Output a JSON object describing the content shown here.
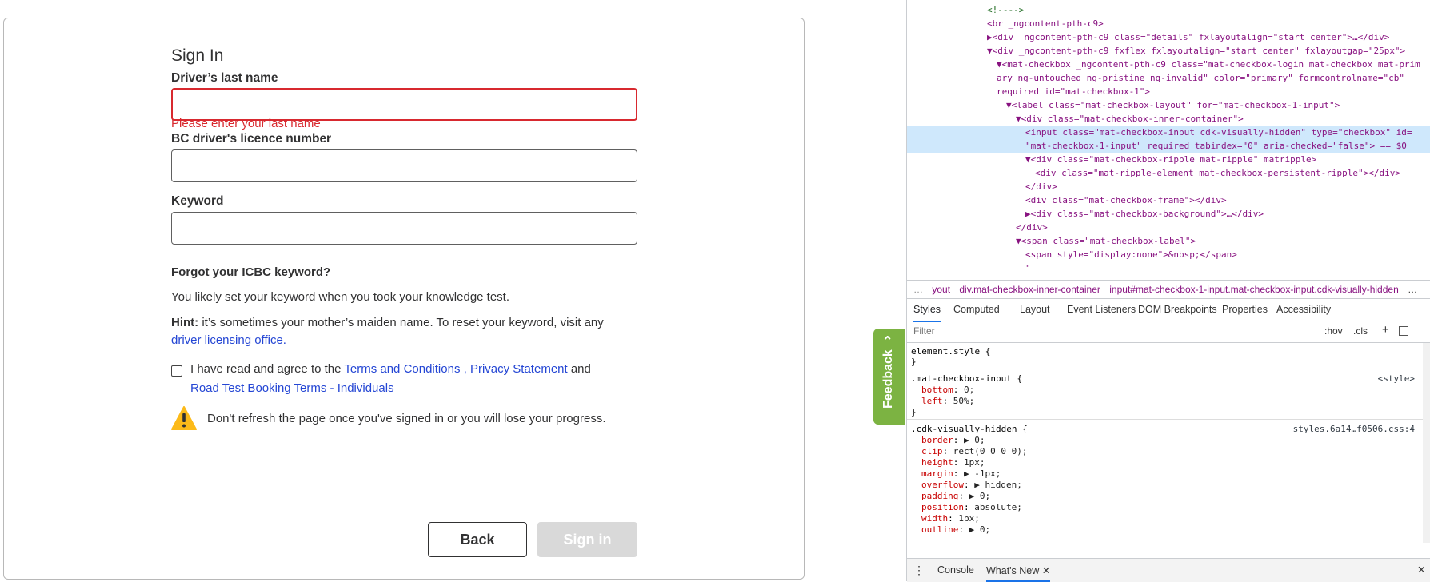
{
  "form": {
    "title": "Sign In",
    "last_name_label": "Driver’s last name",
    "last_name_value": "",
    "last_name_error": "Please enter your last name",
    "licence_label": "BC driver's licence number",
    "licence_value": "",
    "keyword_label": "Keyword",
    "keyword_value": "",
    "forgot_heading": "Forgot your ICBC keyword?",
    "forgot_text": "You likely set your keyword when you took your knowledge test.",
    "hint_label": "Hint:",
    "hint_text": " it’s sometimes your mother’s maiden name. To reset your keyword, visit any",
    "hint_link": "driver licensing office.",
    "agree_prefix": "I have read and agree to the ",
    "terms_link": "Terms and Conditions ,",
    "privacy_link": "Privacy Statement",
    "agree_and": " and",
    "booking_terms_link": "Road Test Booking Terms - Individuals",
    "warning_text": "Don't refresh the page once you've signed in or you will lose your progress.",
    "back_label": "Back",
    "signin_label": "Sign in"
  },
  "feedback_label": "Feedback",
  "devtools": {
    "elements_lines": [
      {
        "indent": 0,
        "html": "<!---->",
        "kind": "comment"
      },
      {
        "indent": 0,
        "text": "<br _ngcontent-pth-c9>"
      },
      {
        "indent": 0,
        "text": "▶<div _ngcontent-pth-c9 class=\"details\" fxlayoutalign=\"start center\">…</div>"
      },
      {
        "indent": 0,
        "text": "▼<div _ngcontent-pth-c9 fxflex fxlayoutalign=\"start center\" fxlayoutgap=\"25px\">"
      },
      {
        "indent": 1,
        "text": "▼<mat-checkbox _ngcontent-pth-c9 class=\"mat-checkbox-login mat-checkbox mat-prim"
      },
      {
        "indent": 1,
        "text": "ary ng-untouched ng-pristine ng-invalid\" color=\"primary\" formcontrolname=\"cb\""
      },
      {
        "indent": 1,
        "text": "required id=\"mat-checkbox-1\">"
      },
      {
        "indent": 2,
        "text": "▼<label class=\"mat-checkbox-layout\" for=\"mat-checkbox-1-input\">"
      },
      {
        "indent": 3,
        "text": "▼<div class=\"mat-checkbox-inner-container\">"
      },
      {
        "indent": 4,
        "text": "<input class=\"mat-checkbox-input cdk-visually-hidden\" type=\"checkbox\" id="
      },
      {
        "indent": 4,
        "text": "\"mat-checkbox-1-input\" required tabindex=\"0\" aria-checked=\"false\"> == $0"
      },
      {
        "indent": 4,
        "text": "▼<div class=\"mat-checkbox-ripple mat-ripple\" matripple>"
      },
      {
        "indent": 5,
        "text": "<div class=\"mat-ripple-element mat-checkbox-persistent-ripple\"></div>"
      },
      {
        "indent": 4,
        "text": "</div>"
      },
      {
        "indent": 4,
        "text": "<div class=\"mat-checkbox-frame\"></div>"
      },
      {
        "indent": 4,
        "text": "▶<div class=\"mat-checkbox-background\">…</div>"
      },
      {
        "indent": 3,
        "text": "</div>"
      },
      {
        "indent": 3,
        "text": "▼<span class=\"mat-checkbox-label\">"
      },
      {
        "indent": 4,
        "text": "<span style=\"display:none\">&nbsp;</span>"
      },
      {
        "indent": 4,
        "text": "\""
      }
    ],
    "crumbs": [
      "…",
      "yout",
      "div.mat-checkbox-inner-container",
      "input#mat-checkbox-1-input.mat-checkbox-input.cdk-visually-hidden",
      "…"
    ],
    "tabs": [
      "Styles",
      "Computed",
      "Layout",
      "Event Listeners",
      "DOM Breakpoints",
      "Properties",
      "Accessibility"
    ],
    "filter_placeholder": "Filter",
    "hov": ":hov",
    "cls": ".cls",
    "plus": "+",
    "rules": {
      "element_style": "element.style {",
      "close": "}",
      "r1_selector": ".mat-checkbox-input {",
      "r1_src": "<style>",
      "r1_p1": "bottom",
      "r1_v1": "0;",
      "r1_p2": "left",
      "r1_v2": "50%;",
      "r2_selector": ".cdk-visually-hidden {",
      "r2_src": "styles.6a14…f0506.css:4",
      "r2_props": [
        {
          "p": "border",
          "v": "▶ 0;"
        },
        {
          "p": "clip",
          "v": "rect(0 0 0 0);"
        },
        {
          "p": "height",
          "v": "1px;"
        },
        {
          "p": "margin",
          "v": "▶ -1px;"
        },
        {
          "p": "overflow",
          "v": "▶ hidden;"
        },
        {
          "p": "padding",
          "v": "▶ 0;"
        },
        {
          "p": "position",
          "v": "absolute;"
        },
        {
          "p": "width",
          "v": "1px;"
        },
        {
          "p": "outline",
          "v": "▶ 0;"
        }
      ]
    },
    "bottom_tabs": [
      "Console",
      "What's New"
    ]
  }
}
